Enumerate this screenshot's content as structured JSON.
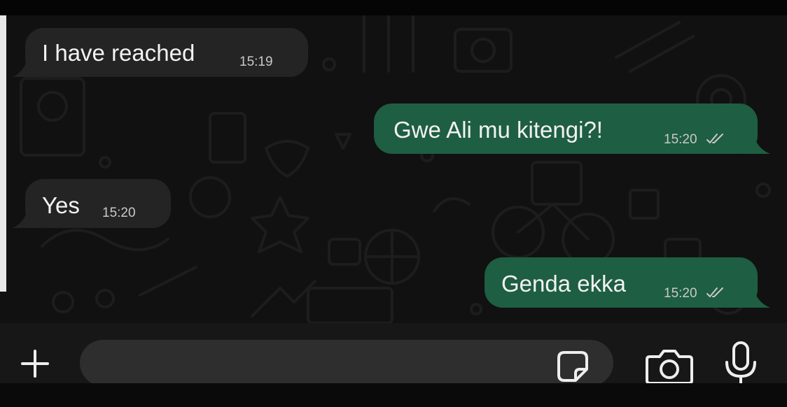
{
  "theme": {
    "incoming_bubble_color": "#242424",
    "outgoing_bubble_color": "#1e5e42",
    "text_color": "#f2f2f2",
    "timestamp_color": "#c9c9c9",
    "input_bar_color": "#171717",
    "input_field_color": "#2e2e2e"
  },
  "messages": [
    {
      "direction": "incoming",
      "text": "I have reached",
      "time": "15:19"
    },
    {
      "direction": "outgoing",
      "text": "Gwe Ali mu kitengi?!",
      "time": "15:20",
      "status": "read-double-check"
    },
    {
      "direction": "incoming",
      "text": "Yes",
      "time": "15:20"
    },
    {
      "direction": "outgoing",
      "text": "Genda ekka",
      "time": "15:20",
      "status": "read-double-check"
    }
  ],
  "input_bar": {
    "message_value": "",
    "message_placeholder": "",
    "icons": {
      "attach": "plus-icon",
      "sticker": "sticker-icon",
      "camera": "camera-icon",
      "mic": "microphone-icon"
    }
  }
}
